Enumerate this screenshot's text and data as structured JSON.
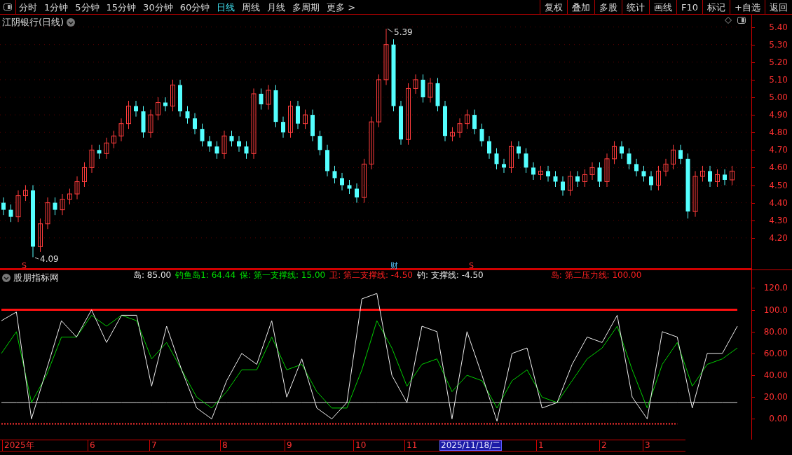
{
  "toolbar": {
    "periods": [
      {
        "label": "分时",
        "selected": false
      },
      {
        "label": "1分钟",
        "selected": false
      },
      {
        "label": "5分钟",
        "selected": false
      },
      {
        "label": "15分钟",
        "selected": false
      },
      {
        "label": "30分钟",
        "selected": false
      },
      {
        "label": "60分钟",
        "selected": false
      },
      {
        "label": "日线",
        "selected": true
      },
      {
        "label": "周线",
        "selected": false
      },
      {
        "label": "月线",
        "selected": false
      },
      {
        "label": "多周期",
        "selected": false
      },
      {
        "label": "更多 >",
        "selected": false
      }
    ],
    "actions": [
      "复权",
      "叠加",
      "多股",
      "统计",
      "画线",
      "F10",
      "标记",
      "+自选",
      "返回"
    ]
  },
  "price_panel": {
    "title": "江阴银行(日线)",
    "high_label": "5.39",
    "low_label": "4.09",
    "markers": [
      "S",
      "财",
      "S"
    ],
    "chart_data": {
      "type": "candlestick",
      "ylim": [
        4.02,
        5.47
      ],
      "grid": true,
      "yticks": [
        {
          "value": 5.4,
          "label": "5.40"
        },
        {
          "value": 5.3,
          "label": "5.30"
        },
        {
          "value": 5.2,
          "label": "5.20"
        },
        {
          "value": 5.1,
          "label": "5.10"
        },
        {
          "value": 5.0,
          "label": "5.00"
        },
        {
          "value": 4.9,
          "label": "4.90"
        },
        {
          "value": 4.8,
          "label": "4.80"
        },
        {
          "value": 4.7,
          "label": "4.70"
        },
        {
          "value": 4.6,
          "label": "4.60"
        },
        {
          "value": 4.5,
          "label": "4.50"
        },
        {
          "value": 4.4,
          "label": "4.40"
        },
        {
          "value": 4.3,
          "label": "4.30"
        },
        {
          "value": 4.2,
          "label": "4.20"
        }
      ],
      "ohlc": [
        [
          4.4,
          4.43,
          4.33,
          4.36
        ],
        [
          4.36,
          4.39,
          4.29,
          4.32
        ],
        [
          4.32,
          4.47,
          4.29,
          4.44
        ],
        [
          4.44,
          4.5,
          4.41,
          4.47
        ],
        [
          4.47,
          4.5,
          4.09,
          4.15
        ],
        [
          4.15,
          4.31,
          4.12,
          4.28
        ],
        [
          4.28,
          4.43,
          4.25,
          4.4
        ],
        [
          4.4,
          4.43,
          4.33,
          4.36
        ],
        [
          4.36,
          4.45,
          4.33,
          4.42
        ],
        [
          4.42,
          4.48,
          4.39,
          4.45
        ],
        [
          4.45,
          4.55,
          4.42,
          4.52
        ],
        [
          4.52,
          4.63,
          4.49,
          4.6
        ],
        [
          4.6,
          4.73,
          4.57,
          4.7
        ],
        [
          4.7,
          4.73,
          4.65,
          4.68
        ],
        [
          4.68,
          4.77,
          4.65,
          4.74
        ],
        [
          4.74,
          4.81,
          4.71,
          4.78
        ],
        [
          4.78,
          4.88,
          4.75,
          4.85
        ],
        [
          4.85,
          4.98,
          4.82,
          4.95
        ],
        [
          4.95,
          4.98,
          4.89,
          4.92
        ],
        [
          4.92,
          4.95,
          4.77,
          4.8
        ],
        [
          4.8,
          4.93,
          4.77,
          4.9
        ],
        [
          4.9,
          5.0,
          4.87,
          4.97
        ],
        [
          4.97,
          5.0,
          4.92,
          4.95
        ],
        [
          4.95,
          5.1,
          4.92,
          5.07
        ],
        [
          5.07,
          5.1,
          4.89,
          4.92
        ],
        [
          4.92,
          4.95,
          4.85,
          4.88
        ],
        [
          4.88,
          4.91,
          4.79,
          4.82
        ],
        [
          4.82,
          4.85,
          4.72,
          4.75
        ],
        [
          4.75,
          4.78,
          4.69,
          4.72
        ],
        [
          4.72,
          4.75,
          4.65,
          4.68
        ],
        [
          4.68,
          4.81,
          4.65,
          4.78
        ],
        [
          4.78,
          4.81,
          4.72,
          4.75
        ],
        [
          4.75,
          4.78,
          4.69,
          4.72
        ],
        [
          4.72,
          4.75,
          4.65,
          4.68
        ],
        [
          4.68,
          5.05,
          4.65,
          5.02
        ],
        [
          5.02,
          5.05,
          4.93,
          4.96
        ],
        [
          4.96,
          5.07,
          4.93,
          5.04
        ],
        [
          5.04,
          5.07,
          4.83,
          4.86
        ],
        [
          4.86,
          4.89,
          4.77,
          4.8
        ],
        [
          4.8,
          4.98,
          4.77,
          4.95
        ],
        [
          4.95,
          4.98,
          4.82,
          4.85
        ],
        [
          4.85,
          4.93,
          4.82,
          4.9
        ],
        [
          4.9,
          4.93,
          4.75,
          4.78
        ],
        [
          4.78,
          4.81,
          4.67,
          4.7
        ],
        [
          4.7,
          4.73,
          4.55,
          4.58
        ],
        [
          4.58,
          4.61,
          4.51,
          4.54
        ],
        [
          4.54,
          4.57,
          4.47,
          4.5
        ],
        [
          4.5,
          4.53,
          4.45,
          4.48
        ],
        [
          4.48,
          4.51,
          4.4,
          4.43
        ],
        [
          4.43,
          4.65,
          4.4,
          4.62
        ],
        [
          4.62,
          4.89,
          4.59,
          4.86
        ],
        [
          4.86,
          5.13,
          4.83,
          5.1
        ],
        [
          5.1,
          5.39,
          5.07,
          5.3
        ],
        [
          5.3,
          5.33,
          4.92,
          4.95
        ],
        [
          4.95,
          4.98,
          4.73,
          4.76
        ],
        [
          4.76,
          5.08,
          4.73,
          5.05
        ],
        [
          5.05,
          5.13,
          5.02,
          5.1
        ],
        [
          5.1,
          5.13,
          4.97,
          5.0
        ],
        [
          5.0,
          5.11,
          4.97,
          5.08
        ],
        [
          5.08,
          5.11,
          4.92,
          4.95
        ],
        [
          4.95,
          4.98,
          4.75,
          4.78
        ],
        [
          4.78,
          4.83,
          4.75,
          4.8
        ],
        [
          4.8,
          4.88,
          4.77,
          4.85
        ],
        [
          4.85,
          4.93,
          4.82,
          4.9
        ],
        [
          4.9,
          4.93,
          4.79,
          4.82
        ],
        [
          4.82,
          4.85,
          4.72,
          4.75
        ],
        [
          4.75,
          4.78,
          4.65,
          4.68
        ],
        [
          4.68,
          4.71,
          4.59,
          4.62
        ],
        [
          4.62,
          4.65,
          4.57,
          4.6
        ],
        [
          4.6,
          4.75,
          4.57,
          4.72
        ],
        [
          4.72,
          4.75,
          4.65,
          4.68
        ],
        [
          4.68,
          4.71,
          4.57,
          4.6
        ],
        [
          4.6,
          4.63,
          4.53,
          4.56
        ],
        [
          4.56,
          4.61,
          4.53,
          4.58
        ],
        [
          4.58,
          4.61,
          4.52,
          4.55
        ],
        [
          4.55,
          4.58,
          4.49,
          4.52
        ],
        [
          4.52,
          4.55,
          4.44,
          4.47
        ],
        [
          4.47,
          4.58,
          4.44,
          4.55
        ],
        [
          4.55,
          4.58,
          4.49,
          4.52
        ],
        [
          4.52,
          4.59,
          4.49,
          4.56
        ],
        [
          4.56,
          4.63,
          4.53,
          4.6
        ],
        [
          4.6,
          4.63,
          4.49,
          4.52
        ],
        [
          4.52,
          4.68,
          4.49,
          4.65
        ],
        [
          4.65,
          4.75,
          4.62,
          4.72
        ],
        [
          4.72,
          4.75,
          4.65,
          4.68
        ],
        [
          4.68,
          4.71,
          4.59,
          4.62
        ],
        [
          4.62,
          4.65,
          4.55,
          4.58
        ],
        [
          4.58,
          4.61,
          4.52,
          4.55
        ],
        [
          4.55,
          4.58,
          4.47,
          4.5
        ],
        [
          4.5,
          4.61,
          4.47,
          4.58
        ],
        [
          4.58,
          4.65,
          4.55,
          4.62
        ],
        [
          4.62,
          4.73,
          4.59,
          4.7
        ],
        [
          4.7,
          4.73,
          4.62,
          4.65
        ],
        [
          4.65,
          4.68,
          4.31,
          4.35
        ],
        [
          4.35,
          4.58,
          4.32,
          4.55
        ],
        [
          4.55,
          4.61,
          4.52,
          4.58
        ],
        [
          4.58,
          4.61,
          4.49,
          4.52
        ],
        [
          4.52,
          4.59,
          4.49,
          4.56
        ],
        [
          4.56,
          4.59,
          4.5,
          4.53
        ],
        [
          4.53,
          4.61,
          4.5,
          4.58
        ]
      ]
    }
  },
  "indicator_panel": {
    "title": "股朋指标网",
    "legend": [
      {
        "text": "岛: 85.00",
        "color": "#e6e6e6"
      },
      {
        "text": "钓鱼岛1: 64.44",
        "color": "#00e000"
      },
      {
        "text": "保: 第一支撑线: 15.00",
        "color": "#00e000"
      },
      {
        "text": "卫: 第二支撑线: -4.50",
        "color": "#ff2020"
      },
      {
        "text": "钓: 支撑线: -4.50",
        "color": "#e6e6e6"
      },
      {
        "text": "岛: 第二压力线: 100.00",
        "color": "#ff2020"
      }
    ],
    "chart_data": {
      "type": "line",
      "ylim": [
        -19.6,
        136.3
      ],
      "yticks": [
        {
          "value": 120,
          "label": "120.0"
        },
        {
          "value": 100,
          "label": "100.0"
        },
        {
          "value": 80,
          "label": "80.00"
        },
        {
          "value": 60,
          "label": "60.00"
        },
        {
          "value": 40,
          "label": "40.00"
        },
        {
          "value": 20,
          "label": "20.00"
        },
        {
          "value": 0,
          "label": "0.00"
        }
      ],
      "series": [
        {
          "color": "#f0f0f0",
          "values": [
            90,
            98,
            0,
            45,
            90,
            75,
            100,
            70,
            95,
            95,
            30,
            85,
            45,
            10,
            0,
            35,
            60,
            50,
            90,
            20,
            55,
            10,
            0,
            15,
            110,
            115,
            40,
            15,
            85,
            80,
            0,
            80,
            40,
            -2,
            60,
            65,
            10,
            15,
            50,
            75,
            70,
            95,
            20,
            0,
            80,
            75,
            10,
            60,
            60,
            85
          ]
        },
        {
          "color": "#00d000",
          "values": [
            60,
            80,
            15,
            40,
            75,
            75,
            95,
            85,
            95,
            90,
            55,
            70,
            45,
            20,
            10,
            25,
            45,
            45,
            75,
            45,
            50,
            25,
            10,
            10,
            45,
            90,
            65,
            30,
            50,
            55,
            25,
            40,
            35,
            10,
            35,
            45,
            20,
            15,
            35,
            55,
            65,
            85,
            45,
            10,
            50,
            70,
            30,
            50,
            55,
            65
          ]
        },
        {
          "color": "#ff1010",
          "values": [
            100,
            100,
            100,
            100,
            100,
            100,
            100,
            100,
            100,
            100,
            100,
            100,
            100,
            100,
            100,
            100,
            100,
            100,
            100,
            100,
            100,
            100,
            100,
            100,
            100,
            100,
            100,
            100,
            100,
            100,
            100,
            100,
            100,
            100,
            100,
            100,
            100,
            100,
            100,
            100,
            100,
            100,
            100,
            100,
            100,
            100,
            100,
            100,
            100,
            100
          ]
        },
        {
          "color": "#dddddd",
          "values": [
            15,
            15,
            15,
            15,
            15,
            15,
            15,
            15,
            15,
            15,
            15,
            15,
            15,
            15,
            15,
            15,
            15,
            15,
            15,
            15,
            15,
            15,
            15,
            15,
            15,
            15,
            15,
            15,
            15,
            15,
            15,
            15,
            15,
            15,
            15,
            15,
            15,
            15,
            15,
            15,
            15,
            15,
            15,
            15,
            15,
            15,
            15,
            15,
            15,
            15
          ]
        },
        {
          "color": "#ff3030",
          "line_style": "dashed",
          "values": [
            -4.5,
            -4.5,
            -4.5,
            -4.5,
            -4.5,
            -4.5,
            -4.5,
            -4.5,
            -4.5,
            -4.5,
            -4.5,
            -4.5,
            -4.5,
            -4.5,
            -4.5,
            -4.5,
            -4.5,
            -4.5,
            -4.5,
            -4.5,
            -4.5,
            -4.5,
            -4.5,
            -4.5,
            -4.5,
            -4.5,
            -4.5,
            -4.5,
            -4.5,
            -4.5,
            -4.5,
            -4.5,
            -4.5,
            -4.5,
            -4.5,
            -4.5,
            -4.5,
            -4.5,
            -4.5,
            -4.5,
            -4.5,
            -4.5,
            -4.5,
            -4.5,
            -4.5,
            -4.5,
            null,
            null,
            null,
            null
          ]
        }
      ]
    }
  },
  "date_bar": {
    "labels": [
      {
        "text": "2025年",
        "selected": false
      },
      {
        "text": "6",
        "selected": false
      },
      {
        "text": "7",
        "selected": false
      },
      {
        "text": "8",
        "selected": false
      },
      {
        "text": "9",
        "selected": false
      },
      {
        "text": "10",
        "selected": false
      },
      {
        "text": "11",
        "selected": false
      },
      {
        "text": "2025/11/18/二",
        "selected": true
      },
      {
        "text": "1",
        "selected": false
      },
      {
        "text": "2",
        "selected": false
      },
      {
        "text": "3",
        "selected": false
      }
    ]
  }
}
